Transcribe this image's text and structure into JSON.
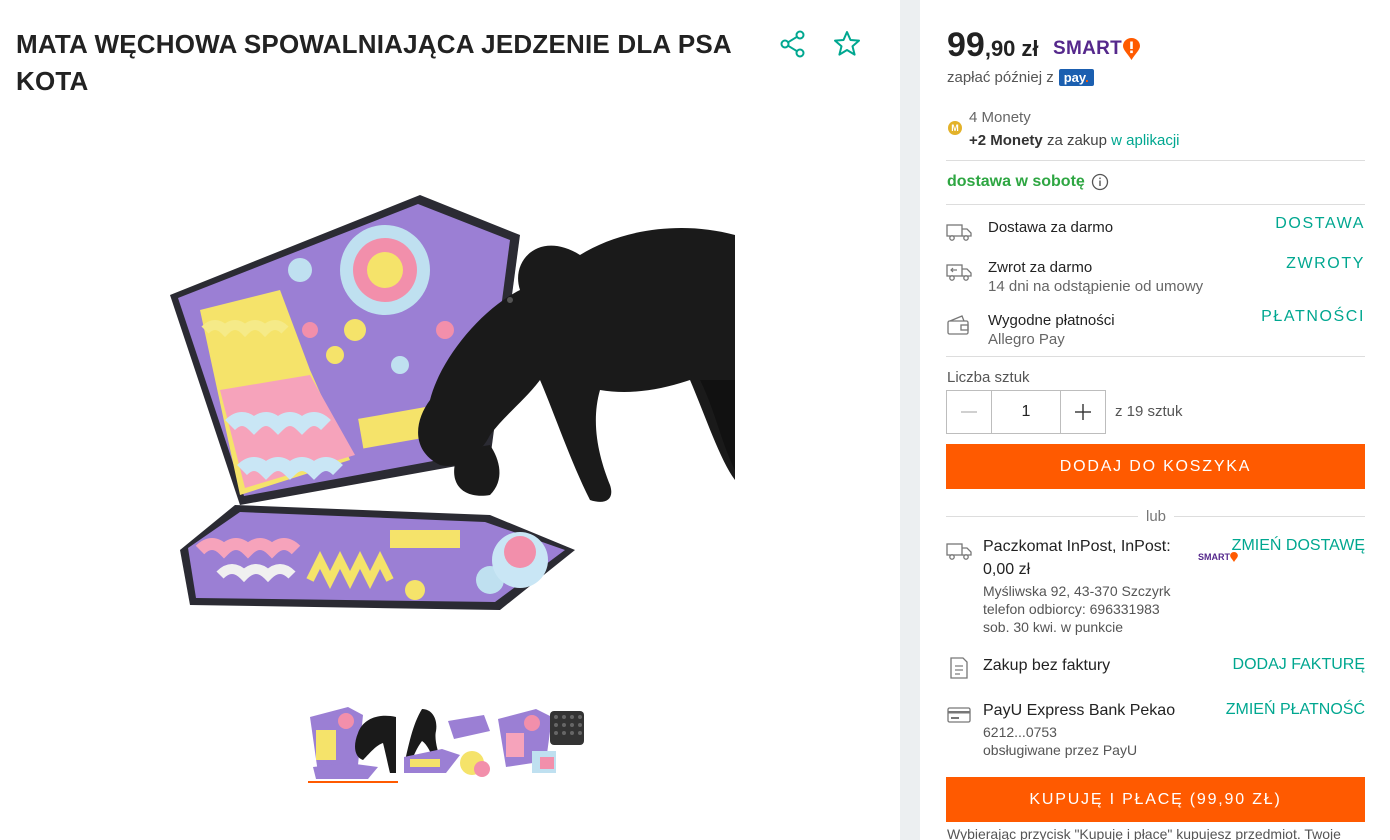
{
  "product": {
    "title": "MATA WĘCHOWA SPOWALNIAJĄCA JEDZENIE DLA PSA KOTA"
  },
  "gallery": {
    "thumbnails": [
      "thumb-1",
      "thumb-2",
      "thumb-3"
    ],
    "active_index": 0
  },
  "price": {
    "integer": "99",
    "decimal": ",90",
    "currency": "zł",
    "smart_label": "SMART"
  },
  "pay_later": {
    "text": "zapłać później z",
    "badge": "pay",
    "badge_dot": "."
  },
  "coins": {
    "count_text": "4 Monety",
    "bonus_bold": "+2 Monety",
    "bonus_text": " za zakup ",
    "bonus_link": "w aplikacji"
  },
  "delivery_day": "dostawa w sobotę",
  "features": [
    {
      "title": "Dostawa za darmo",
      "sub": "",
      "link": "DOSTAWA",
      "icon": "truck-icon"
    },
    {
      "title": "Zwrot za darmo",
      "sub": "14 dni na odstąpienie od umowy",
      "link": "ZWROTY",
      "icon": "return-truck-icon"
    },
    {
      "title": "Wygodne płatności",
      "sub": "Allegro Pay",
      "link": "PŁATNOŚCI",
      "icon": "wallet-icon"
    }
  ],
  "quantity": {
    "label": "Liczba sztuk",
    "value": "1",
    "of_text": "z 19 sztuk"
  },
  "add_to_cart": "DODAJ DO KOSZYKA",
  "or_text": "lub",
  "checkout": {
    "delivery_title_1": "Paczkomat InPost, InPost:",
    "delivery_title_2": "0,00 zł",
    "delivery_address": "Myśliwska 92, 43-370 Szczyrk",
    "delivery_phone": "telefon odbiorcy: 696331983",
    "delivery_date": "sob. 30 kwi. w punkcie",
    "delivery_smart": "SMART",
    "delivery_link": "ZMIEŃ DOSTAWĘ",
    "invoice_title": "Zakup bez faktury",
    "invoice_link": "DODAJ FAKTURĘ",
    "payment_title": "PayU Express Bank Pekao",
    "payment_card": "6212...0753",
    "payment_by": "obsługiwane przez PayU",
    "payment_link": "ZMIEŃ PŁATNOŚĆ"
  },
  "buy_now": "KUPUJĘ I PŁACĘ (99,90 ZŁ)",
  "disclaimer": "Wybierając przycisk \"Kupuję i płacę\" kupujesz przedmiot. Twoje",
  "colors": {
    "accent_orange": "#ff5a00",
    "link_teal": "#00a790",
    "smart_purple": "#55288c",
    "delivery_green": "#2ea642"
  }
}
